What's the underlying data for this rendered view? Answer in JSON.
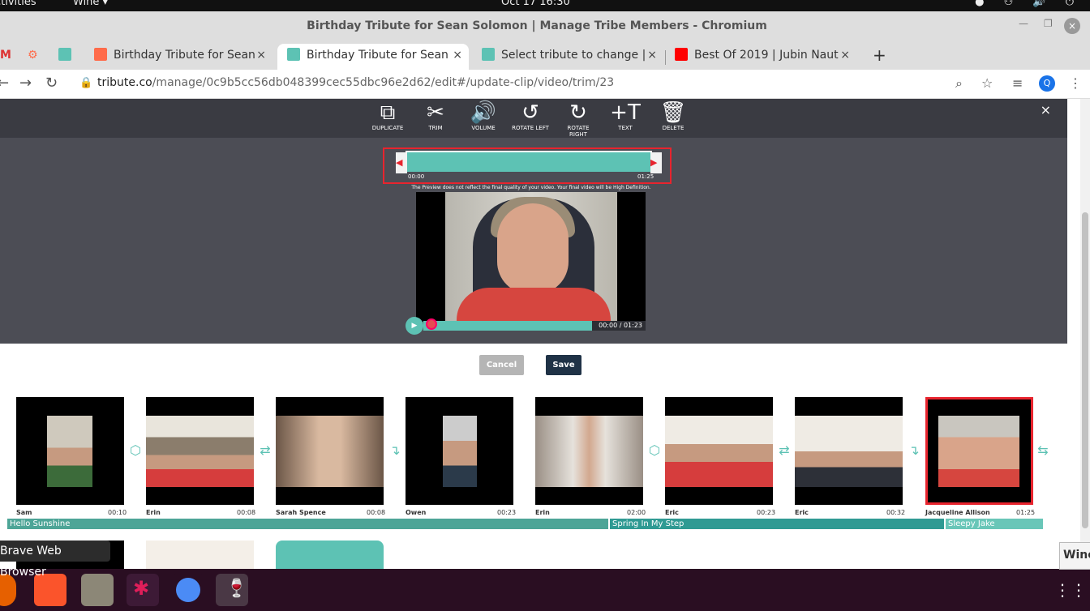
{
  "system": {
    "activities": "ctivities",
    "app_menu": "Wine ▾",
    "clock": "Oct 17  16:30"
  },
  "window": {
    "title": "Birthday Tribute for Sean Solomon | Manage Tribe Members - Chromium"
  },
  "tabs": [
    {
      "label": "Birthday Tribute for Sean",
      "favicon_color": "#ff6b4a"
    },
    {
      "label": "Birthday Tribute for Sean",
      "favicon_color": "#5dc2b4",
      "active": true
    },
    {
      "label": "Select tribute to change |",
      "favicon_color": "#5dc2b4"
    },
    {
      "label": "Best Of 2019 | Jubin Naut",
      "favicon_color": "#ff0000"
    }
  ],
  "address": {
    "domain": "tribute.co",
    "path": "/manage/0c9b5cc56db048399cec55dbc96e2d62/edit#/update-clip/video/trim/23",
    "avatar": "Q"
  },
  "editor": {
    "tools": [
      {
        "icon": "duplicate-icon",
        "glyph": "⧉",
        "label": "DUPLICATE"
      },
      {
        "icon": "scissors-icon",
        "glyph": "✂",
        "label": "TRIM"
      },
      {
        "icon": "volume-icon",
        "glyph": "🔊",
        "label": "VOLUME"
      },
      {
        "icon": "rotate-left-icon",
        "glyph": "↺",
        "label": "ROTATE LEFT"
      },
      {
        "icon": "rotate-right-icon",
        "glyph": "↻",
        "label": "ROTATE RIGHT"
      },
      {
        "icon": "text-icon",
        "glyph": "+T",
        "label": "TEXT"
      },
      {
        "icon": "trash-icon",
        "glyph": "🗑",
        "label": "DELETE"
      }
    ],
    "close": "×",
    "trim_start": "00:00",
    "trim_end": "01:25",
    "preview_note": "The Preview does not reflect the final quality of your video. Your final video will be High Definition.",
    "playback_time": "00:00 / 01:23",
    "progress_fraction": 0.76,
    "cancel_label": "Cancel",
    "save_label": "Save"
  },
  "clips": [
    {
      "name": "Sam",
      "duration": "00:10",
      "transition": "cube"
    },
    {
      "name": "Erin",
      "duration": "00:08",
      "transition": "swap"
    },
    {
      "name": "Sarah Spence",
      "duration": "00:08",
      "transition": "cut"
    },
    {
      "name": "Owen",
      "duration": "00:23",
      "transition": ""
    },
    {
      "name": "Erin",
      "duration": "02:00",
      "transition": "cube"
    },
    {
      "name": "Eric",
      "duration": "00:23",
      "transition": "swap"
    },
    {
      "name": "Eric",
      "duration": "00:32",
      "transition": "cut"
    },
    {
      "name": "Jacqueline Allison",
      "duration": "01:25",
      "transition": "shuffle",
      "selected": true
    }
  ],
  "songs": [
    {
      "title": "Hello Sunshine",
      "color": "#4da597"
    },
    {
      "title": "Spring In My Step",
      "color": "#2f9a93"
    },
    {
      "title": "Sleepy Jake",
      "color": "#69c6b8"
    }
  ],
  "tooltip": "Brave Web Browser",
  "wine_popup": "Wine"
}
